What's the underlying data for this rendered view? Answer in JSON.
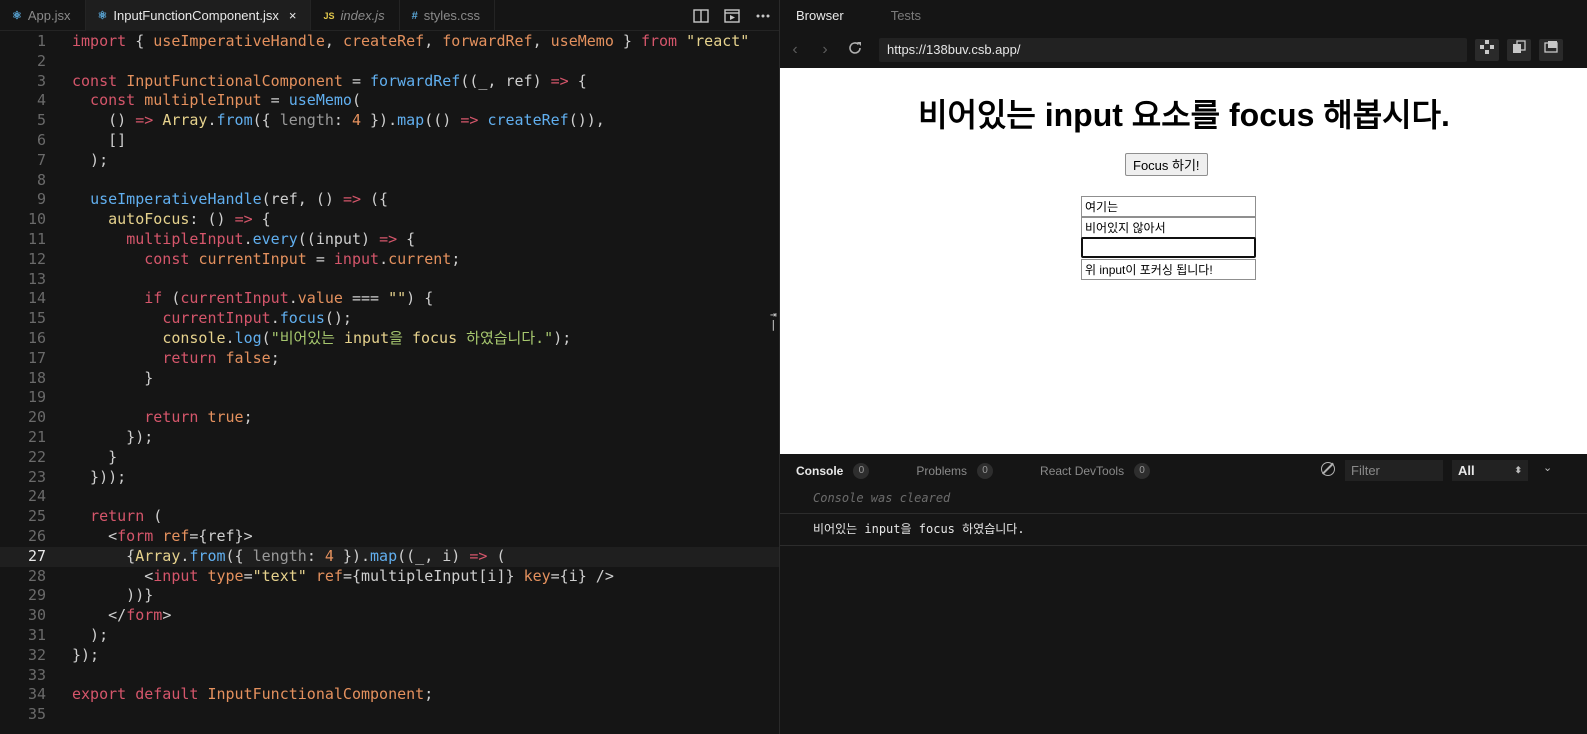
{
  "editor": {
    "tabs": [
      {
        "label": "App.jsx",
        "icon": "react-icon"
      },
      {
        "label": "InputFunctionComponent.jsx",
        "icon": "react-icon",
        "close": "×"
      },
      {
        "label": "index.js",
        "icon": "js-icon",
        "icon_text": "JS"
      },
      {
        "label": "styles.css",
        "icon": "css-hash-icon",
        "icon_text": "#"
      }
    ],
    "current_line": 27,
    "line_numbers": [
      "1",
      "2",
      "3",
      "4",
      "5",
      "6",
      "7",
      "8",
      "9",
      "10",
      "11",
      "12",
      "13",
      "14",
      "15",
      "16",
      "17",
      "18",
      "19",
      "20",
      "21",
      "22",
      "23",
      "24",
      "25",
      "26",
      "27",
      "28",
      "29",
      "30",
      "31",
      "32",
      "33",
      "34",
      "35"
    ]
  },
  "code": {
    "l1": {
      "a": "import",
      "b": " { ",
      "c": "useImperativeHandle",
      "d": ", ",
      "e": "createRef",
      "f": ", ",
      "g": "forwardRef",
      "h": ", ",
      "i": "useMemo",
      "j": " } ",
      "k": "from",
      "l": " ",
      "m": "\"react\""
    },
    "l3": {
      "a": "const",
      "b": " ",
      "c": "InputFunctionalComponent",
      "d": " = ",
      "e": "forwardRef",
      "f": "((_, ref) ",
      "g": "=>",
      "h": " {"
    },
    "l4": {
      "a": "  const",
      "b": " ",
      "c": "multipleInput",
      "d": " = ",
      "e": "useMemo",
      "f": "("
    },
    "l5": {
      "a": "    () ",
      "b": "=>",
      "c": " ",
      "d": "Array",
      "e": ".",
      "f": "from",
      "g": "({ ",
      "h": "length",
      "i": ": ",
      "j": "4",
      "k": " }).",
      "l": "map",
      "m": "(() ",
      "n": "=>",
      "o": " ",
      "p": "createRef",
      "q": "()),"
    },
    "l6": "    []",
    "l7": "  );",
    "l9": {
      "a": "  ",
      "b": "useImperativeHandle",
      "c": "(ref, () ",
      "d": "=>",
      "e": " ({"
    },
    "l10": {
      "a": "    ",
      "b": "autoFocus",
      "c": ": () ",
      "d": "=>",
      "e": " {"
    },
    "l11": {
      "a": "      ",
      "b": "multipleInput",
      "c": ".",
      "d": "every",
      "e": "((input) ",
      "f": "=>",
      "g": " {"
    },
    "l12": {
      "a": "        ",
      "b": "const",
      "c": " ",
      "d": "currentInput",
      "e": " = ",
      "f": "input",
      "g": ".",
      "h": "current",
      "i": ";"
    },
    "l14": {
      "a": "        ",
      "b": "if",
      "c": " (",
      "d": "currentInput",
      "e": ".",
      "f": "value",
      "g": " === ",
      "h": "\"\"",
      "i": ") {"
    },
    "l15": {
      "a": "          ",
      "b": "currentInput",
      "c": ".",
      "d": "focus",
      "e": "();"
    },
    "l16": {
      "a": "          ",
      "b": "console",
      "c": ".",
      "d": "log",
      "e": "(",
      "f": "\"비어있는 ",
      "g": "input",
      "h": "을 ",
      "i": "focus",
      "j": " 하였습니다.\"",
      "k": ");"
    },
    "l17": {
      "a": "          ",
      "b": "return",
      "c": " ",
      "d": "false",
      "e": ";"
    },
    "l18": "        }",
    "l20": {
      "a": "        ",
      "b": "return",
      "c": " ",
      "d": "true",
      "e": ";"
    },
    "l21": "      });",
    "l22": "    }",
    "l23": "  }));",
    "l25": {
      "a": "  ",
      "b": "return",
      "c": " ("
    },
    "l26": {
      "a": "    <",
      "b": "form",
      "c": " ",
      "d": "ref",
      "e": "={ref}>"
    },
    "l27": {
      "a": "      {",
      "b": "Array",
      "c": ".",
      "d": "from",
      "e": "({ ",
      "f": "length",
      "g": ": ",
      "h": "4",
      "i": " }).",
      "j": "map",
      "k": "((_, i) ",
      "l": "=>",
      "m": " ("
    },
    "l28": {
      "a": "        <",
      "b": "input",
      "c": " ",
      "d": "type",
      "e": "=",
      "f": "\"text\"",
      "g": " ",
      "h": "ref",
      "i": "={multipleInput[i]} ",
      "j": "key",
      "k": "={i} />"
    },
    "l29": "      ))}",
    "l30": {
      "a": "    </",
      "b": "form",
      "c": ">"
    },
    "l31": "  );",
    "l32": "});",
    "l34": {
      "a": "export",
      "b": " ",
      "c": "default",
      "d": " ",
      "e": "InputFunctionalComponent",
      "f": ";"
    }
  },
  "preview": {
    "tabs": [
      "Browser",
      "Tests"
    ],
    "url": "https://138buv.csb.app/",
    "heading": "비어있는 input 요소를 focus 해봅시다.",
    "focus_button": "Focus 하기!",
    "inputs": [
      "여기는",
      "비어있지 않아서",
      "",
      "위 input이 포커싱 됩니다!"
    ]
  },
  "console": {
    "tabs": [
      {
        "label": "Console",
        "count": "0"
      },
      {
        "label": "Problems",
        "count": "0"
      },
      {
        "label": "React DevTools",
        "count": "0"
      }
    ],
    "filter_placeholder": "Filter",
    "level": "All",
    "cleared_text": "Console was cleared",
    "log": "비어있는 input을 focus 하였습니다."
  },
  "colors": {
    "keyword": "#d5566b",
    "function": "#61afef",
    "identifier": "#e4915e",
    "string": "#e6d28d",
    "background": "#151515"
  }
}
